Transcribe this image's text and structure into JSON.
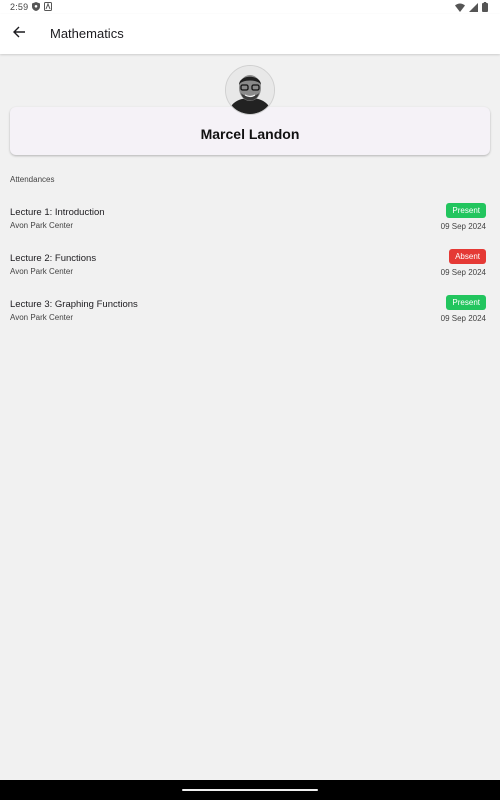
{
  "status_bar": {
    "time": "2:59"
  },
  "app_bar": {
    "title": "Mathematics"
  },
  "profile": {
    "name": "Marcel Landon"
  },
  "attendances": {
    "section_label": "Attendances",
    "items": [
      {
        "title": "Lecture 1: Introduction",
        "location": "Avon Park Center",
        "status": "Present",
        "date": "09 Sep 2024"
      },
      {
        "title": "Lecture 2: Functions",
        "location": "Avon Park Center",
        "status": "Absent",
        "date": "09 Sep 2024"
      },
      {
        "title": "Lecture 3: Graphing Functions",
        "location": "Avon Park Center",
        "status": "Present",
        "date": "09 Sep 2024"
      }
    ]
  },
  "colors": {
    "present": "#22c55e",
    "absent": "#e53935",
    "card": "#f5f2f7",
    "background": "#f1f1f1"
  },
  "icons": [
    "shield-icon",
    "a-icon",
    "wifi-icon",
    "signal-icon",
    "battery-icon",
    "back-arrow-icon",
    "avatar"
  ]
}
